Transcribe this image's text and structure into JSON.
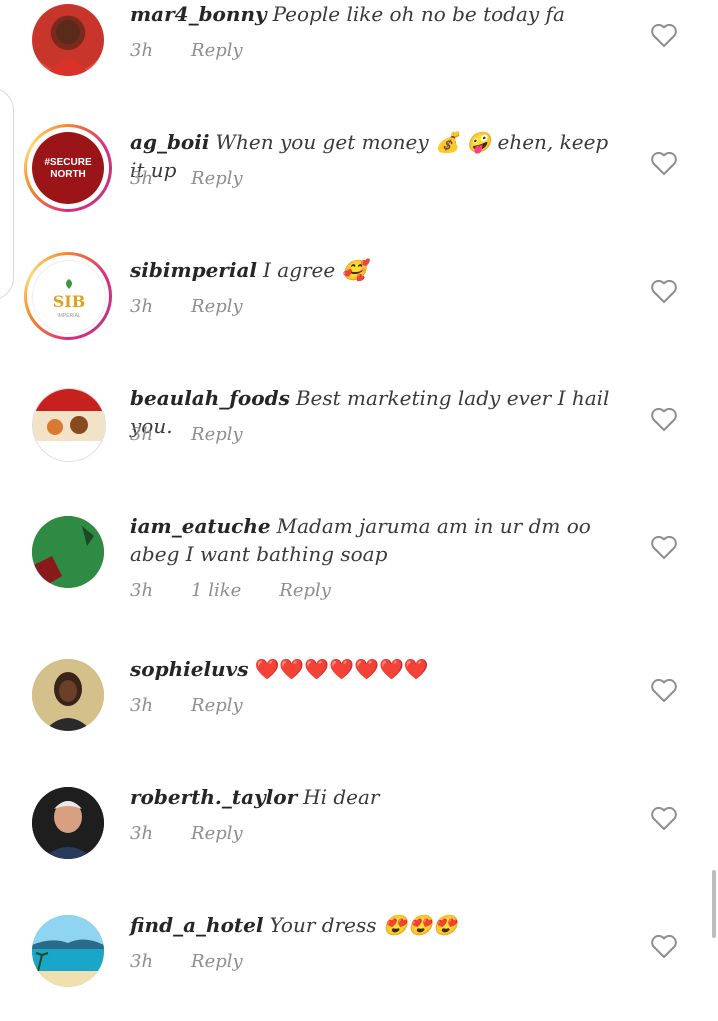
{
  "comments": [
    {
      "username": "mar4_bonny",
      "text": "People like oh no be today fa",
      "time": "3h",
      "likes": "",
      "reply": "Reply",
      "avatar": "woman-red-avatar",
      "story_ring": false
    },
    {
      "username": "ag_boii",
      "text": "When you get money 💰 🤪 ehen, keep it up",
      "time": "3h",
      "likes": "",
      "reply": "Reply",
      "avatar": "secure-north-logo",
      "avatar_text": "#SECURE NORTH",
      "story_ring": true
    },
    {
      "username": "sibimperial",
      "text": "I agree 🥰",
      "time": "3h",
      "likes": "",
      "reply": "Reply",
      "avatar": "sib-logo",
      "avatar_text": "SIB",
      "story_ring": true
    },
    {
      "username": "beaulah_foods",
      "text": "Best marketing lady ever I hail you.",
      "time": "3h",
      "likes": "",
      "reply": "Reply",
      "avatar": "beaulah-foods-logo",
      "story_ring": false
    },
    {
      "username": "iam_eatuche",
      "text": "Madam jaruma am in ur dm oo abeg I want bathing soap",
      "time": "3h",
      "likes": "1 like",
      "reply": "Reply",
      "avatar": "green-pattern-avatar",
      "story_ring": false
    },
    {
      "username": "sophieluvs",
      "text": "❤️❤️❤️❤️❤️❤️❤️",
      "time": "3h",
      "likes": "",
      "reply": "Reply",
      "avatar": "woman-avatar",
      "story_ring": false
    },
    {
      "username": "roberth._taylor",
      "text": "Hi dear",
      "time": "3h",
      "likes": "",
      "reply": "Reply",
      "avatar": "man-avatar",
      "story_ring": false
    },
    {
      "username": "find_a_hotel",
      "text": "Your dress 😍😍😍",
      "time": "3h",
      "likes": "",
      "reply": "Reply",
      "avatar": "beach-avatar",
      "story_ring": false
    }
  ],
  "icons": {
    "like": "heart-outline-icon"
  },
  "colors": {
    "ring_start": "#f58529",
    "ring_mid": "#dd2a7b",
    "meta": "#8e8e8e"
  }
}
